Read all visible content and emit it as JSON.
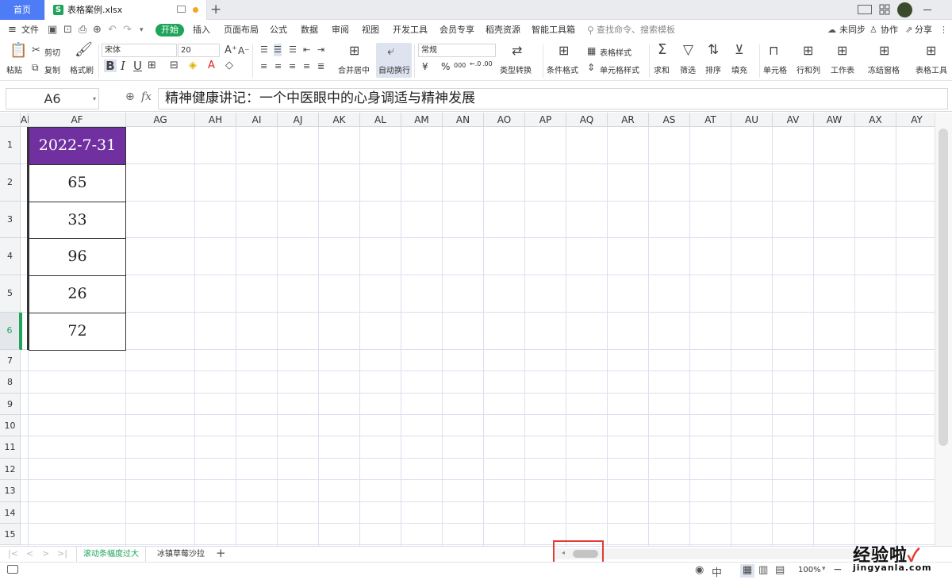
{
  "titlebar": {
    "home_tab": "首页",
    "file_tab": "表格案例.xlsx",
    "file_icon": "S",
    "new_tab_icon": "+"
  },
  "menubar": {
    "file_menu": "文件",
    "tabs": [
      "开始",
      "插入",
      "页面布局",
      "公式",
      "数据",
      "审阅",
      "视图",
      "开发工具",
      "会员专享",
      "稻壳资源",
      "智能工具箱"
    ],
    "search_placeholder": "查找命令、搜索模板",
    "unsync": "未同步",
    "collab": "协作",
    "share": "分享"
  },
  "ribbon": {
    "paste": "粘贴",
    "cut": "剪切",
    "copy": "复制",
    "format_painter": "格式刷",
    "font_name": "宋体",
    "font_size": "20",
    "bold": "B",
    "italic": "I",
    "underline": "U",
    "merge_center": "合并居中",
    "wrap_text": "自动换行",
    "number_format": "常规",
    "currency": "¥",
    "percent": "%",
    "thousands": "000",
    "type_convert": "类型转换",
    "conditional_format": "条件格式",
    "table_style": "表格样式",
    "cell_style": "单元格样式",
    "sum": "求和",
    "filter": "筛选",
    "sort": "排序",
    "fill": "填充",
    "cell": "单元格",
    "row_col": "行和列",
    "worksheet": "工作表",
    "freeze": "冻结窗格",
    "table_tools": "表格工具"
  },
  "formula_bar": {
    "name_box": "A6",
    "fx": "fx",
    "content": "精神健康讲记：一个中医眼中的心身调适与精神发展"
  },
  "grid": {
    "columns": [
      "AE",
      "AF",
      "AG",
      "AH",
      "AI",
      "AJ",
      "AK",
      "AL",
      "AM",
      "AN",
      "AO",
      "AP",
      "AQ",
      "AR",
      "AS",
      "AT",
      "AU",
      "AV",
      "AW",
      "AX",
      "AY"
    ],
    "rows": [
      "1",
      "2",
      "3",
      "4",
      "5",
      "6",
      "7",
      "8",
      "9",
      "10",
      "11",
      "12",
      "13",
      "14",
      "15"
    ],
    "af_cells": [
      "2022-7-31",
      "65",
      "33",
      "96",
      "26",
      "72"
    ],
    "header_fill": "#7030a0",
    "header_text": "#ffffff"
  },
  "sheets": {
    "active": "滚动条幅度过大",
    "other": "冰镇草莓沙拉",
    "add": "+"
  },
  "statusbar": {
    "zoom": "100%"
  },
  "watermark": {
    "title": "经验啦",
    "check": "✓",
    "url": "jingyanla.com"
  }
}
